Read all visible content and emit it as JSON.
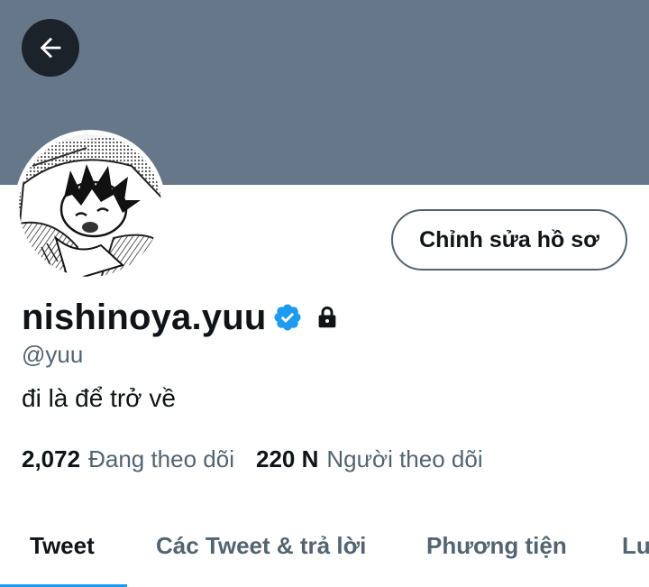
{
  "header": {
    "back_icon": "arrow-left-icon",
    "banner_color": "#66778a"
  },
  "profile": {
    "avatar_icon": "manga-character-avatar",
    "edit_button_label": "Chỉnh sửa hồ sơ",
    "display_name": "nishinoya.yuu",
    "verified_icon": "verified-badge-icon",
    "protected_icon": "lock-icon",
    "handle": "@yuu",
    "bio": "đi là để trở về",
    "following_count": "2,072",
    "following_label": "Đang theo dõi",
    "followers_count": "220 N",
    "followers_label": "Người theo dõi"
  },
  "tabs": [
    {
      "label": "Tweet",
      "active": true
    },
    {
      "label": "Các Tweet & trả lời"
    },
    {
      "label": "Phương tiện"
    },
    {
      "label": "Lu"
    }
  ],
  "colors": {
    "accent": "#1d9bf0",
    "text_primary": "#0f1419",
    "text_secondary": "#536471"
  }
}
